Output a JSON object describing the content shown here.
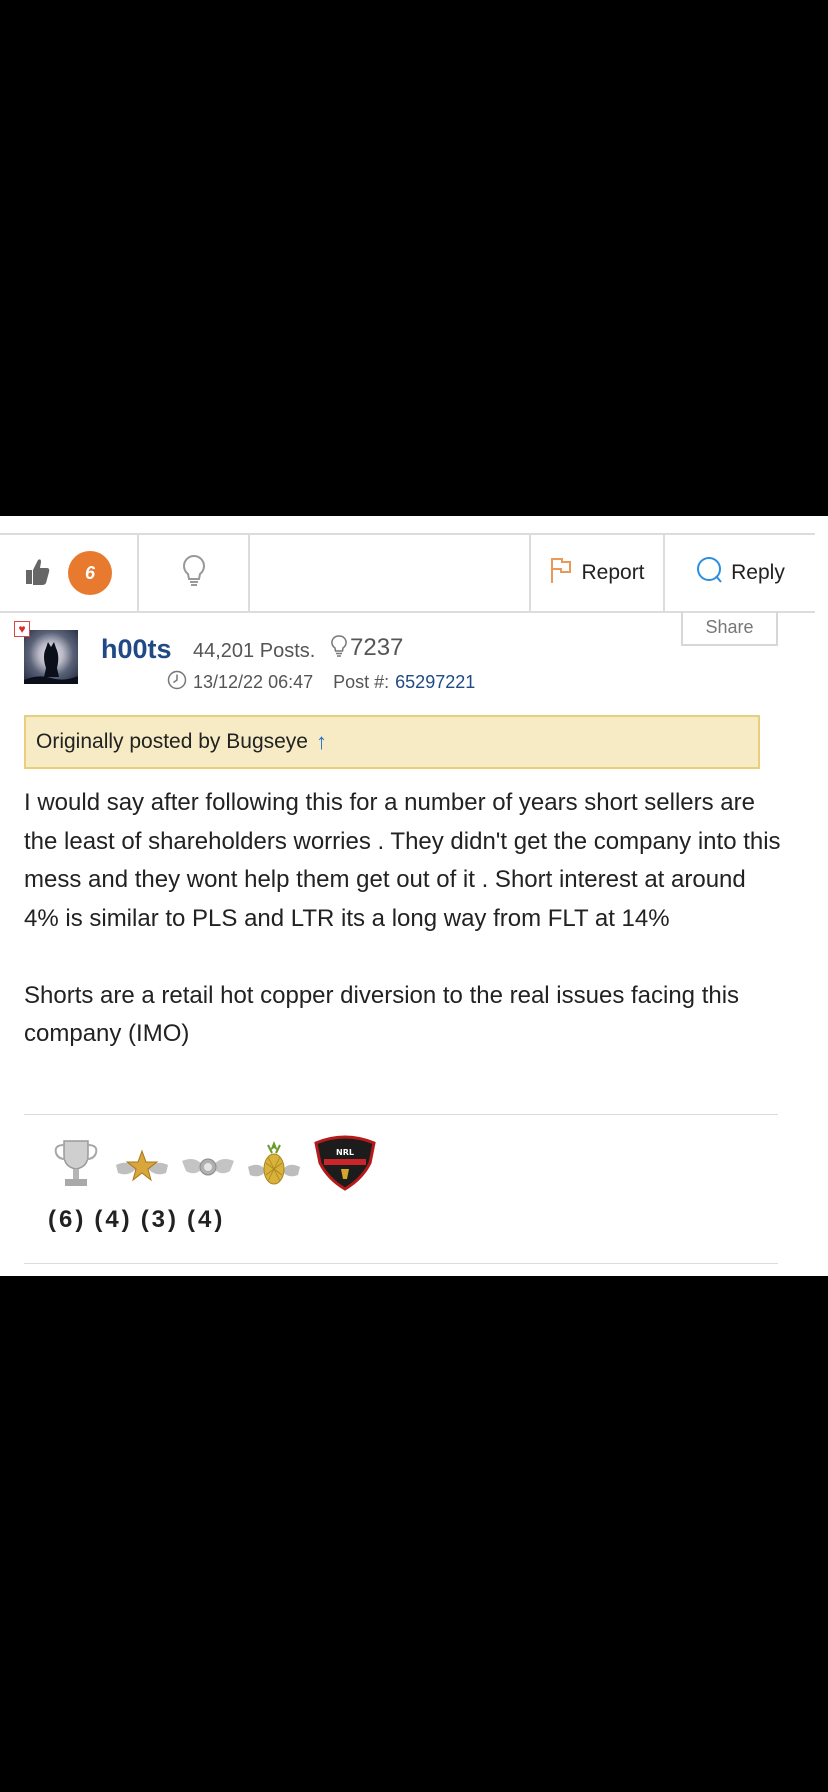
{
  "action_bar": {
    "like_count": "6",
    "report_label": "Report",
    "reply_label": "Reply"
  },
  "post": {
    "share_label": "Share",
    "author": "h00ts",
    "posts_count": "44,201 Posts.",
    "likes_received": "7237",
    "timestamp": "13/12/22 06:47",
    "post_number_label": "Post #:",
    "post_number": "65297221",
    "quote_label": "Originally posted by Bugseye",
    "quote_arrow": "↑",
    "body": [
      "I would say after following this for a number of years short sellers are the least of shareholders worries . They didn't get the company into this mess and they wont help them get out of it . Short interest at around 4% is similar to PLS and LTR its a long way from FLT at 14%",
      "Shorts are a retail hot copper diversion to the real issues facing this company (IMO)"
    ]
  },
  "awards": {
    "icons": [
      "trophy-icon",
      "gold-star-wings-icon",
      "silver-wings-icon",
      "pineapple-wings-icon",
      "shield-badge-icon"
    ],
    "badge_text": "NRL",
    "counts": [
      "(6)",
      "(4)",
      "(3)",
      "(4)"
    ]
  },
  "colors": {
    "accent_orange": "#e87a2f",
    "link_blue": "#1f4a86",
    "quote_bg": "#f6ebc4"
  }
}
